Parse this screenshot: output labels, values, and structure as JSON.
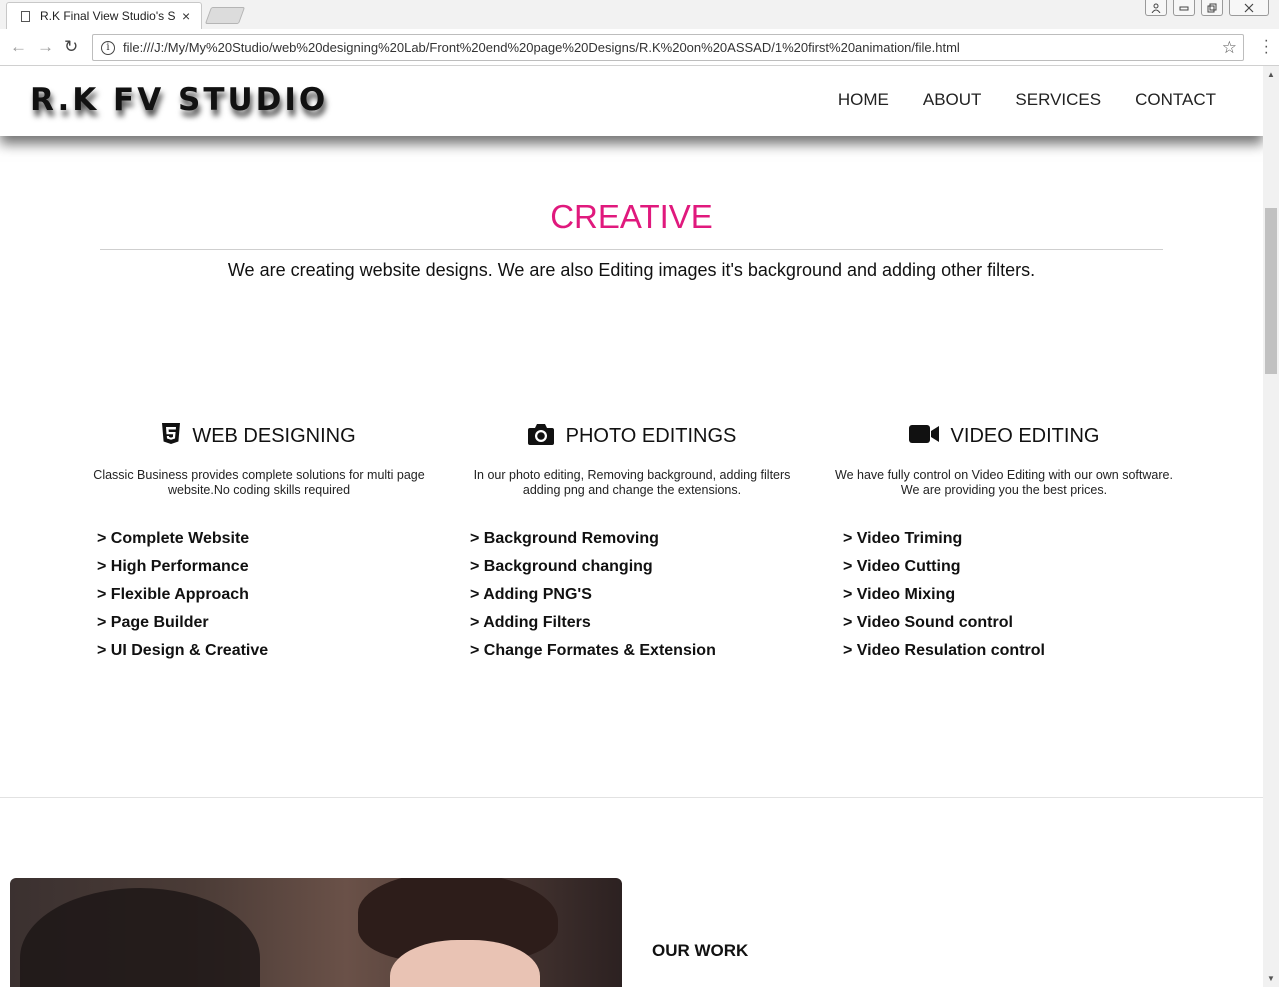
{
  "browser": {
    "tab_title": "R.K Final View Studio's Si",
    "url": "file:///J:/My/My%20Studio/web%20designing%20Lab/Front%20end%20page%20Designs/R.K%20on%20ASSAD/1%20first%20animation/file.html",
    "back_icon": "←",
    "forward_icon": "→",
    "reload_icon": "↻",
    "star_icon": "☆",
    "close_tab_icon": "×"
  },
  "site": {
    "logo": "R.K FV STUDIO",
    "nav": [
      "HOME",
      "ABOUT",
      "SERVICES",
      "CONTACT"
    ],
    "creative_heading": "CREATIVE",
    "intro": "We are creating website designs. We are also Editing images it's background and adding other filters.",
    "accent_color": "#e0197d",
    "services": [
      {
        "icon": "html5-icon",
        "title": "WEB DESIGNING",
        "description": "Classic Business provides complete solutions for multi page website.No coding skills required",
        "features": [
          "> Complete Website",
          "> High Performance",
          "> Flexible Approach",
          "> Page Builder",
          "> UI Design & Creative"
        ]
      },
      {
        "icon": "camera-icon",
        "title": "PHOTO EDITINGS",
        "description": "In our photo editing, Removing background, adding filters adding png and change the extensions.",
        "features": [
          "> Background Removing",
          "> Background changing",
          "> Adding PNG'S",
          "> Adding Filters",
          "> Change Formates & Extension"
        ]
      },
      {
        "icon": "video-camera-icon",
        "title": "VIDEO EDITING",
        "description": "We have fully control on Video Editing with our own software. We are providing you the best prices.",
        "features": [
          "> Video Triming",
          "> Video Cutting",
          "> Video Mixing",
          "> Video Sound control",
          "> Video Resulation control"
        ]
      }
    ],
    "our_work": "OUR WORK"
  }
}
